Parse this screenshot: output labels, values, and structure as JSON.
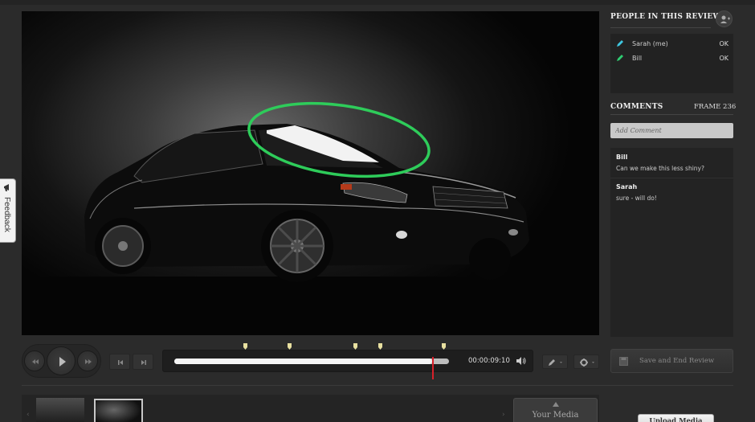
{
  "feedback": {
    "label": "Feedback",
    "icon": "megaphone-icon"
  },
  "people": {
    "title": "PEOPLE IN THIS REVIEW",
    "add_icon": "add-person-icon",
    "members": [
      {
        "name": "Sarah (me)",
        "status": "OK",
        "icon": "pen-icon",
        "color": "#3ec6e0"
      },
      {
        "name": "Bill",
        "status": "OK",
        "icon": "pen-icon",
        "color": "#2ecc71"
      }
    ]
  },
  "comments": {
    "title": "COMMENTS",
    "frame": "FRAME 236",
    "input_placeholder": "Add Comment",
    "items": [
      {
        "author": "Bill",
        "text": "Can we make this less shiny?"
      },
      {
        "author": "Sarah",
        "text": "sure - will do!"
      }
    ]
  },
  "player": {
    "timecode": "00:00:09:10",
    "progress": 0.94,
    "annotation_color": "#2ecc5a",
    "markers": [
      0.26,
      0.42,
      0.66,
      0.75,
      0.98
    ]
  },
  "save_button": {
    "label": "Save and End Review"
  },
  "media": {
    "your_media_label": "Your Media",
    "upload_label": "Upload Media"
  }
}
